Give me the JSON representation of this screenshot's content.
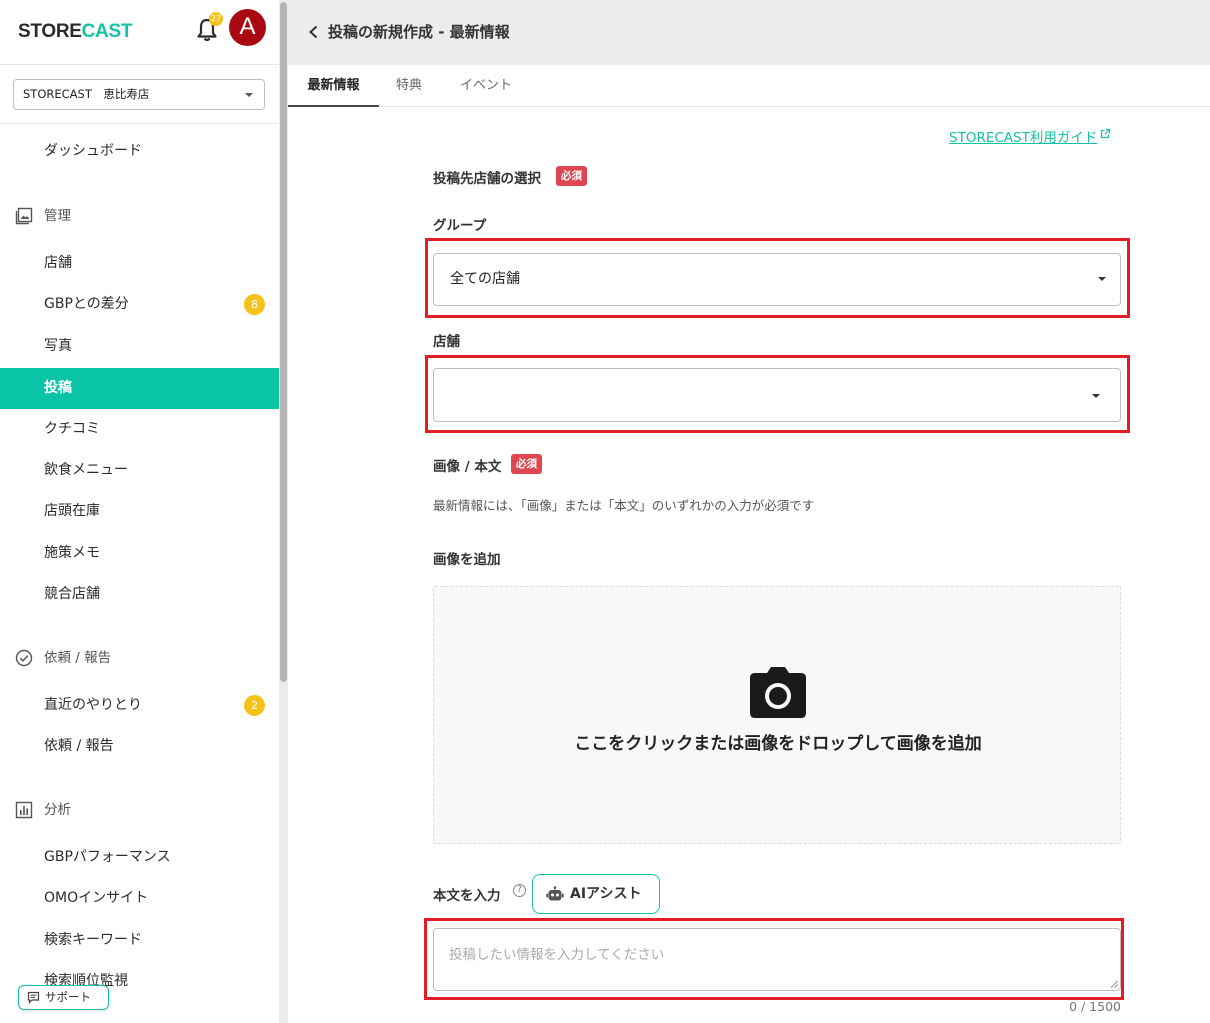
{
  "app": {
    "logo_store": "STORE",
    "logo_cast": "CAST",
    "notification_count": "27",
    "avatar_letter": "A"
  },
  "store_selector": {
    "value": "STORECAST　恵比寿店"
  },
  "sidebar": {
    "dashboard": "ダッシュボード",
    "sections": [
      {
        "title": "管理",
        "icon": "image-icon"
      },
      {
        "title": "依頼 / 報告",
        "icon": "check-circle-icon"
      },
      {
        "title": "分析",
        "icon": "bar-chart-icon"
      }
    ],
    "manage_items": [
      {
        "label": "店舗"
      },
      {
        "label": "GBPとの差分",
        "badge": "8"
      },
      {
        "label": "写真"
      },
      {
        "label": "投稿",
        "active": true
      },
      {
        "label": "クチコミ"
      },
      {
        "label": "飲食メニュー"
      },
      {
        "label": "店頭在庫"
      },
      {
        "label": "施策メモ"
      },
      {
        "label": "競合店舗"
      }
    ],
    "request_items": [
      {
        "label": "直近のやりとり",
        "badge": "2"
      },
      {
        "label": "依頼 / 報告"
      }
    ],
    "analysis_items": [
      {
        "label": "GBPパフォーマンス"
      },
      {
        "label": "OMOインサイト"
      },
      {
        "label": "検索キーワード"
      },
      {
        "label": "検索順位監視"
      }
    ],
    "support_label": "サポート"
  },
  "header": {
    "title": "投稿の新規作成 - 最新情報"
  },
  "tabs": [
    {
      "label": "最新情報",
      "active": true
    },
    {
      "label": "特典"
    },
    {
      "label": "イベント"
    }
  ],
  "form": {
    "guide_link": "STORECAST利用ガイド",
    "target_label": "投稿先店舗の選択",
    "required_badge": "必須",
    "group_label": "グループ",
    "group_value": "全ての店舗",
    "store_label": "店舗",
    "store_value": "",
    "image_text_label": "画像 / 本文",
    "image_text_hint": "最新情報には、「画像」または「本文」のいずれかの入力が必須です",
    "add_image_label": "画像を追加",
    "dropzone_text": "ここをクリックまたは画像をドロップして画像を追加",
    "body_label": "本文を入力",
    "help_glyph": "?",
    "ai_assist_label": "AIアシスト",
    "body_placeholder": "投稿したい情報を入力してください",
    "counter": "0 / 1500"
  },
  "colors": {
    "brand": "#13c3a6",
    "active_nav": "#0ac5a5",
    "badge": "#f7c21a",
    "required": "#de4650",
    "highlight_frame": "#e31c26",
    "avatar": "#a90a12"
  }
}
